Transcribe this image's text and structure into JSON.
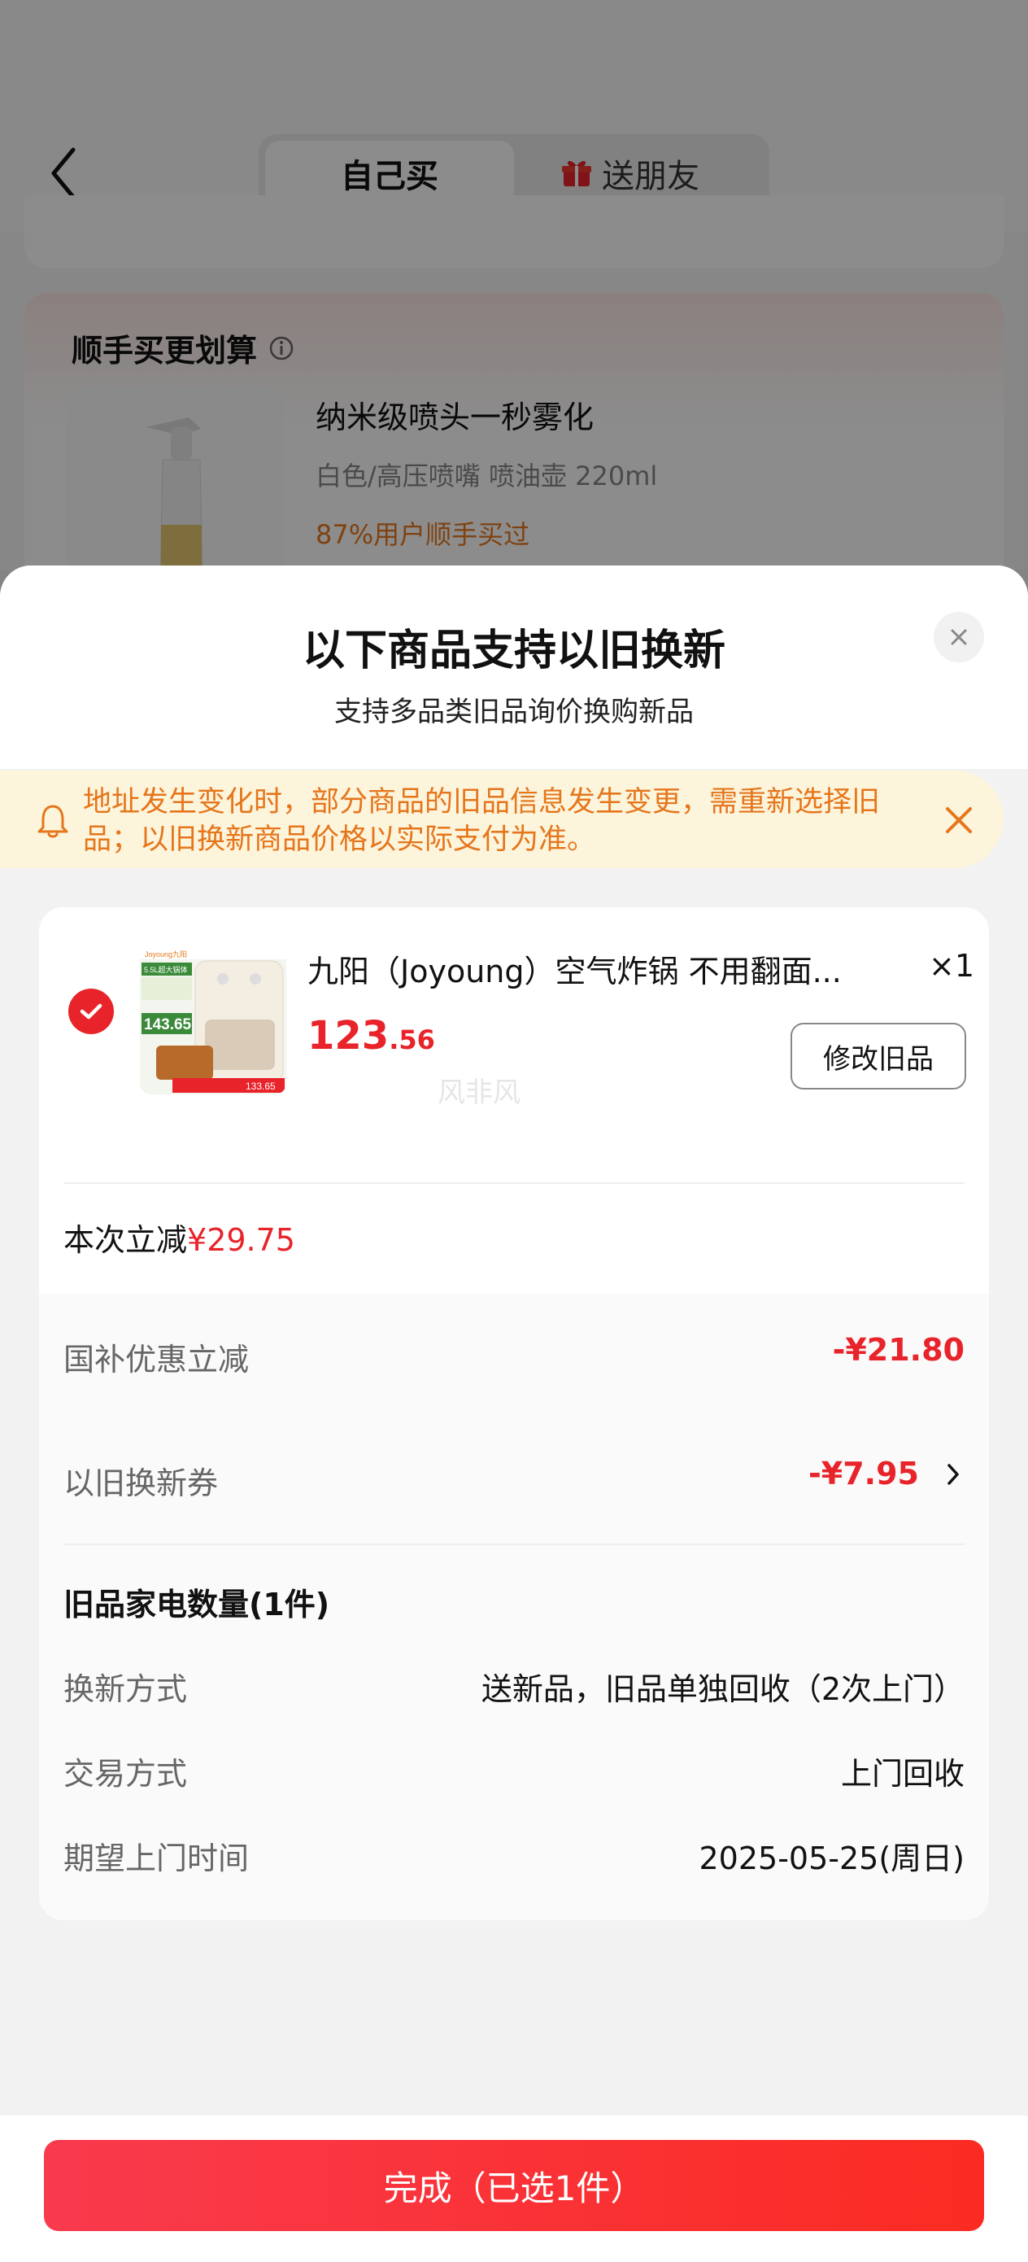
{
  "header": {
    "tab_self": "自己买",
    "tab_gift": "送朋友"
  },
  "promo": {
    "title": "顺手买更划算",
    "product_name": "纳米级喷头一秒雾化",
    "product_spec": "白色/高压喷嘴 喷油壶 220ml",
    "product_tag": "87%用户顺手买过"
  },
  "sheet": {
    "title": "以下商品支持以旧换新",
    "subtitle": "支持多品类旧品询价换购新品",
    "notice": "地址发生变化时，部分商品的旧品信息发生变更，需重新选择旧品；以旧换新商品价格以实际支付为准。"
  },
  "item": {
    "name": "九阳（Joyoung）空气炸锅 不用翻面...",
    "qty": "×1",
    "price_int": "123",
    "price_dec": ".56",
    "edit_label": "修改旧品",
    "watermark": "风非风",
    "thumb_brand": "Joyoung九阳",
    "thumb_badge1": "5.5L超大锅体",
    "thumb_price": "143.65",
    "thumb_bottom": "133.65",
    "save_label": "本次立减",
    "save_amount": "¥29.75"
  },
  "discounts": {
    "national_label": "国补优惠立减",
    "national_value": "-¥21.80",
    "coupon_label": "以旧换新券",
    "coupon_value": "-¥7.95"
  },
  "old_goods": {
    "title": "旧品家电数量(1件)",
    "method_label": "换新方式",
    "method_value": "送新品，旧品单独回收（2次上门）",
    "trade_label": "交易方式",
    "trade_value": "上门回收",
    "time_label": "期望上门时间",
    "time_value": "2025-05-25(周日)"
  },
  "footer": {
    "done_label": "完成（已选1件）"
  },
  "colors": {
    "accent_red": "#e8232a",
    "notice_bg": "#fdf4dc",
    "notice_text": "#e5761b",
    "promo_tag": "#e8781e"
  }
}
